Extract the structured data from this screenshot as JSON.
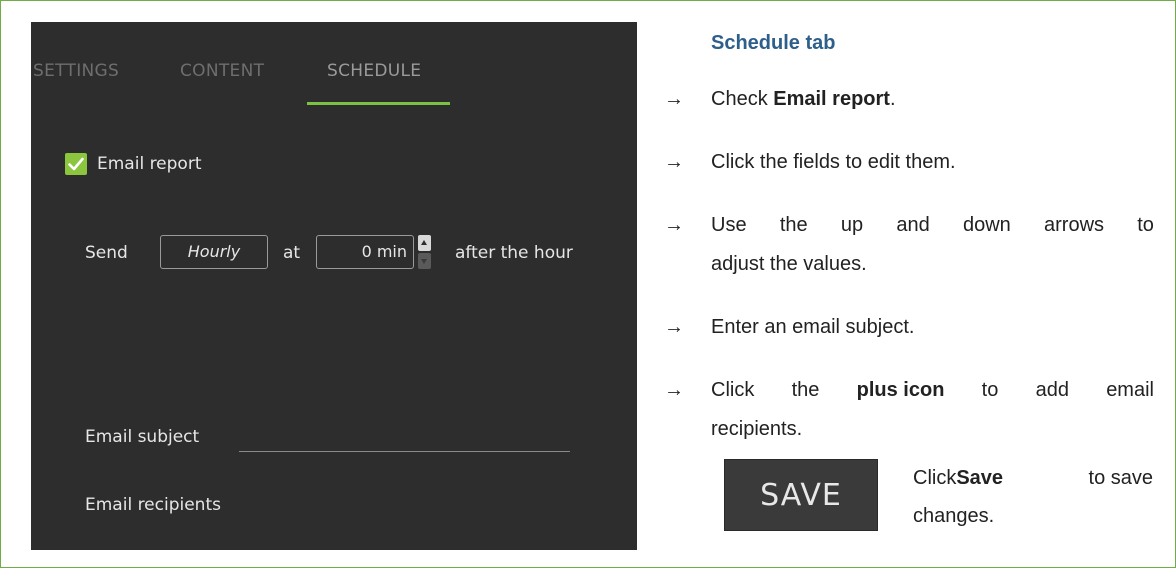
{
  "app_panel": {
    "tabs": [
      {
        "label": "SETTINGS",
        "active": false
      },
      {
        "label": "CONTENT",
        "active": false
      },
      {
        "label": "SCHEDULE",
        "active": true
      }
    ],
    "accent_color": "#7cc242",
    "email_report": {
      "label": "Email report",
      "checked": true
    },
    "send_row": {
      "send_label": "Send",
      "frequency_value": "Hourly",
      "at_label": "at",
      "minutes_value": "0 min",
      "after_label": "after the hour"
    },
    "email_subject_label": "Email subject",
    "email_subject_value": "",
    "email_recipients_label": "Email recipients"
  },
  "instructions": {
    "title": "Schedule tab",
    "arrow_glyph": "→",
    "steps": [
      {
        "pre": "Check ",
        "bold": "Email report",
        "post": "."
      },
      {
        "text": "Click the fields to edit them."
      },
      {
        "line1_words": [
          "Use",
          "the",
          "up",
          "and",
          "down",
          "arrows",
          "to"
        ],
        "line2": "adjust the values."
      },
      {
        "text": "Enter an email subject."
      },
      {
        "line1_words": [
          "Click",
          "the",
          "plus icon",
          "to",
          "add",
          "email"
        ],
        "line2": "recipients."
      }
    ],
    "save_button_label": "SAVE",
    "save_note": {
      "pre": "Click ",
      "bold": "Save",
      "mid": " to save",
      "line2": "changes."
    }
  }
}
